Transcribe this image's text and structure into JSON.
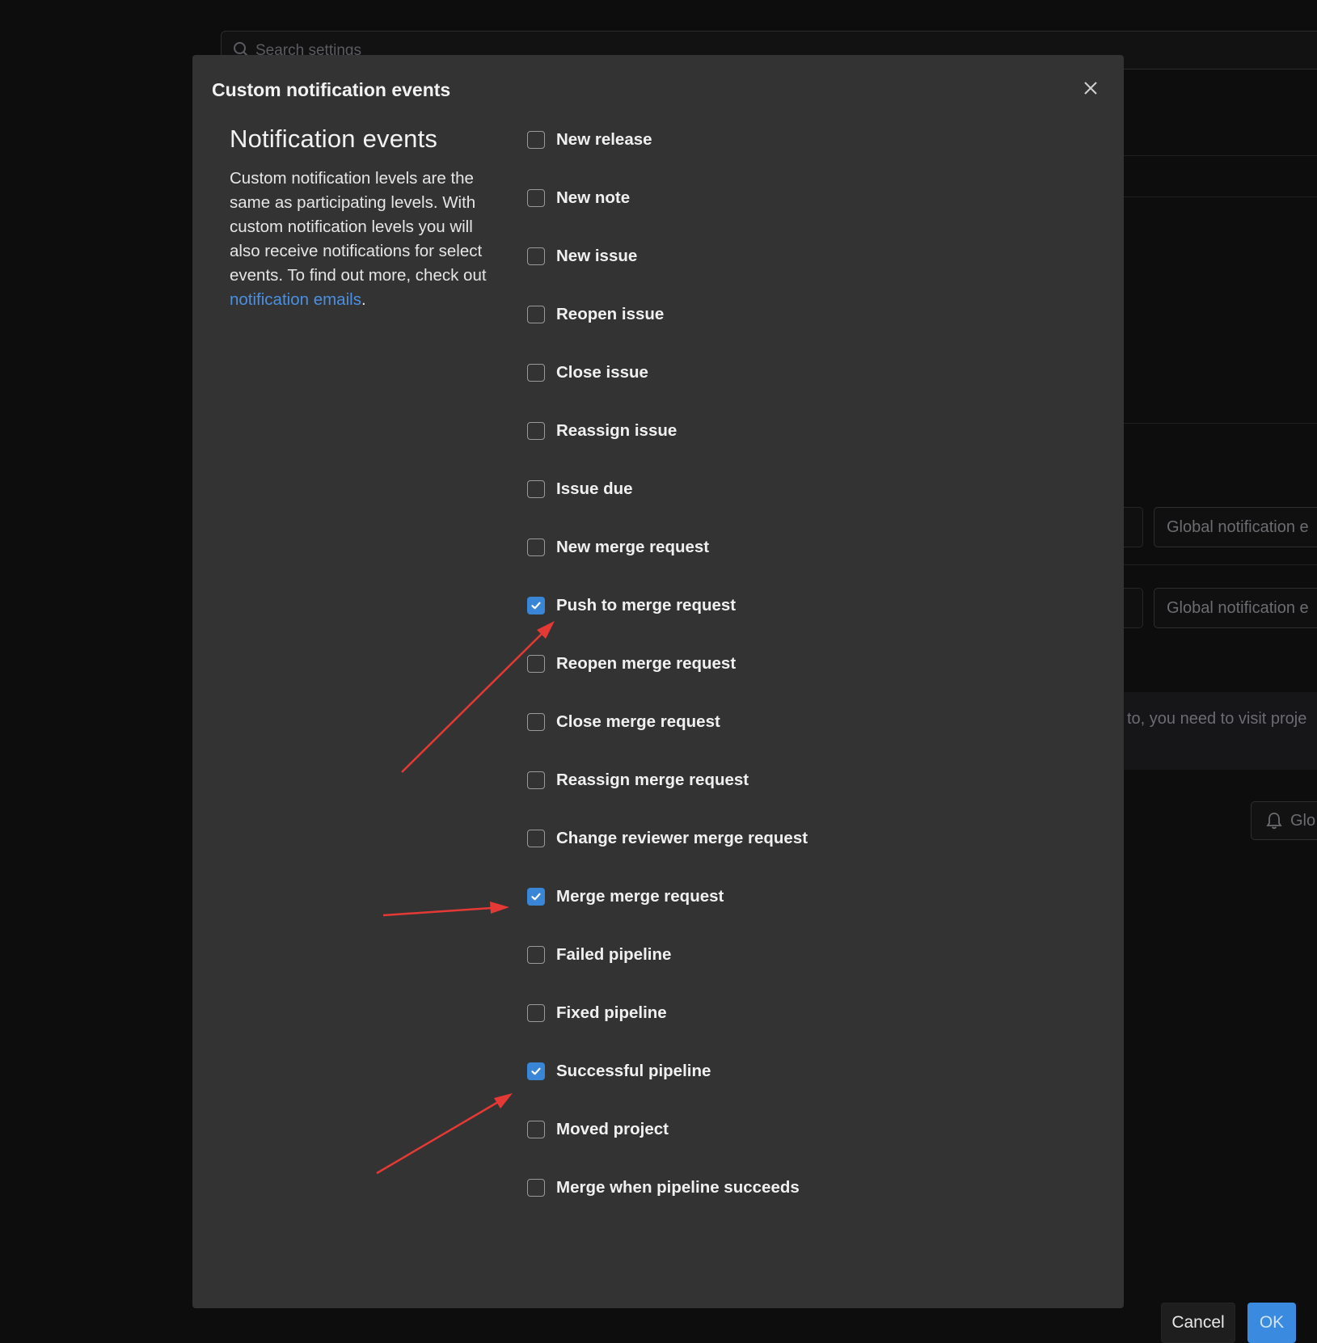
{
  "background": {
    "search_placeholder": "Search settings",
    "select_1": "Global notification e",
    "select_2": "Global notification e",
    "info_text": "to, you need to visit proje",
    "global_button": "Glo"
  },
  "modal": {
    "title": "Custom notification events",
    "heading": "Notification events",
    "description": "Custom notification levels are the same as participating levels. With custom notification levels you will also receive notifications for select events. To find out more, check out ",
    "link_text": "notification emails",
    "description_end": ".",
    "events": [
      {
        "label": "New release",
        "checked": false
      },
      {
        "label": "New note",
        "checked": false
      },
      {
        "label": "New issue",
        "checked": false
      },
      {
        "label": "Reopen issue",
        "checked": false
      },
      {
        "label": "Close issue",
        "checked": false
      },
      {
        "label": "Reassign issue",
        "checked": false
      },
      {
        "label": "Issue due",
        "checked": false
      },
      {
        "label": "New merge request",
        "checked": false
      },
      {
        "label": "Push to merge request",
        "checked": true
      },
      {
        "label": "Reopen merge request",
        "checked": false
      },
      {
        "label": "Close merge request",
        "checked": false
      },
      {
        "label": "Reassign merge request",
        "checked": false
      },
      {
        "label": "Change reviewer merge request",
        "checked": false
      },
      {
        "label": "Merge merge request",
        "checked": true
      },
      {
        "label": "Failed pipeline",
        "checked": false
      },
      {
        "label": "Fixed pipeline",
        "checked": false
      },
      {
        "label": "Successful pipeline",
        "checked": true
      },
      {
        "label": "Moved project",
        "checked": false
      },
      {
        "label": "Merge when pipeline succeeds",
        "checked": false
      }
    ],
    "cancel_label": "Cancel",
    "ok_label": "OK"
  },
  "colors": {
    "accent": "#3a86d6",
    "link": "#4a90e2",
    "annotation_arrow": "#e53935",
    "modal_bg": "#333333"
  },
  "icons": {
    "close": "close-icon",
    "checkbox_check": "check-icon",
    "search": "search-icon",
    "bell": "bell-icon"
  }
}
